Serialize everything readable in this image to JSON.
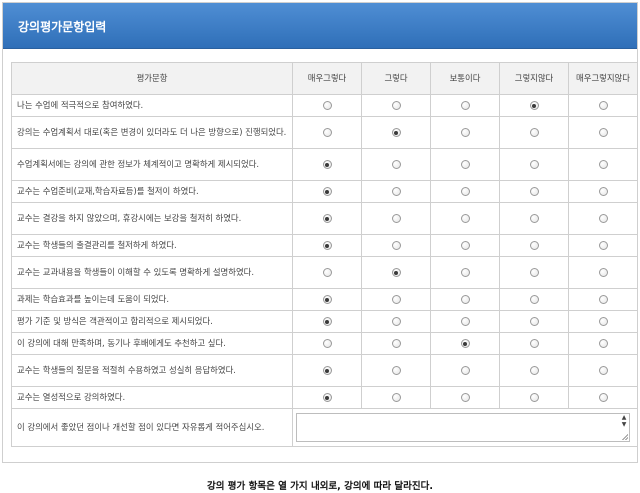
{
  "header": {
    "title": "강의평가문항입력"
  },
  "table": {
    "question_header": "평가문항",
    "options": [
      "매우그렇다",
      "그렇다",
      "보통이다",
      "그렇지않다",
      "매우그렇지않다"
    ],
    "rows": [
      {
        "text": "나는 수업에 적극적으로 참여하였다.",
        "selected": 3
      },
      {
        "text": "강의는 수업계획서 대로(혹은 변경이 있더라도 더 나은 방향으로) 진행되었다.",
        "selected": 1
      },
      {
        "text": "수업계획서에는 강의에 관한 정보가 체계적이고 명확하게 제시되었다.",
        "selected": 0
      },
      {
        "text": "교수는 수업준비(교재,학습자료등)를 철저이 하였다.",
        "selected": 0
      },
      {
        "text": "교수는 결강을 하지 않았으며, 휴강시에는 보강을 철저히 하였다.",
        "selected": 0
      },
      {
        "text": "교수는 학생들의 출결관리를 철저하게 하였다.",
        "selected": 0
      },
      {
        "text": "교수는 교과내용을 학생들이 이해할 수 있도록 명확하게 설명하였다.",
        "selected": 1
      },
      {
        "text": "과제는 학습효과를 높이는데 도움이 되었다.",
        "selected": 0
      },
      {
        "text": "평가 기준 및 방식은 객관적이고 합리적으로 제시되었다.",
        "selected": 0
      },
      {
        "text": "이 강의에 대해 만족하며, 동기나 후배에게도 추천하고 싶다.",
        "selected": 2
      },
      {
        "text": "교수는 학생들의 질문을 적절히 수용하였고 성실히 응답하였다.",
        "selected": 0
      },
      {
        "text": "교수는 열성적으로 강의하였다.",
        "selected": 0
      }
    ],
    "comment_label": "이 강의에서 좋았던 점이나 개선할 점이 있다면 자유롭게 적어주십시오.",
    "comment_value": ""
  },
  "caption": "강의 평가 항목은 열 가지 내외로, 강의에 따라 달라진다."
}
